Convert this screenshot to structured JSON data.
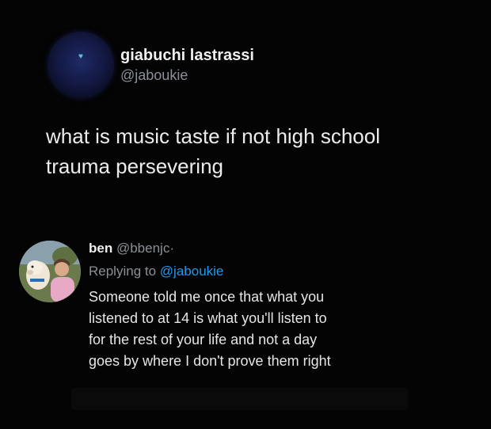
{
  "tweet": {
    "author_name": "giabuchi lastrassi",
    "author_handle": "@jaboukie",
    "avatar_icon": "heart-icon",
    "avatar_color": "#1f2a66",
    "text_line1": "what is music taste if not high school",
    "text_line2": "trauma persevering"
  },
  "reply": {
    "author_name": "ben",
    "author_handle": "@bbenjc",
    "separator": "·",
    "replying_prefix": "Replying to",
    "replying_handle": "@jaboukie",
    "mention_color": "#1d9bf0",
    "text_lines": [
      "Someone told me once that what you",
      "listened to at 14 is what you'll listen to",
      "for the rest of your life and not a day",
      "goes by where I don't prove them right"
    ]
  }
}
